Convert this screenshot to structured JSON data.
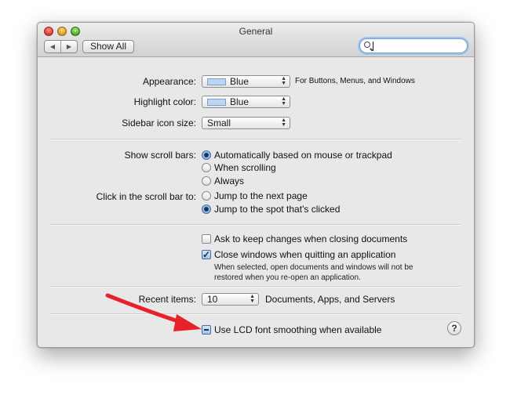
{
  "window": {
    "title": "General"
  },
  "toolbar": {
    "back": "◀",
    "forward": "▶",
    "show_all": "Show All",
    "search_placeholder": ""
  },
  "appearance": {
    "label": "Appearance:",
    "value": "Blue",
    "note": "For Buttons, Menus, and Windows"
  },
  "highlight": {
    "label": "Highlight color:",
    "value": "Blue"
  },
  "sidebar_icon": {
    "label": "Sidebar icon size:",
    "value": "Small"
  },
  "scroll_bars": {
    "label": "Show scroll bars:",
    "options": [
      "Automatically based on mouse or trackpad",
      "When scrolling",
      "Always"
    ],
    "selected": "Automatically based on mouse or trackpad"
  },
  "click_scroll": {
    "label": "Click in the scroll bar to:",
    "options": [
      "Jump to the next page",
      "Jump to the spot that's clicked"
    ],
    "selected": "Jump to the spot that's clicked"
  },
  "documents": {
    "ask_keep": {
      "label": "Ask to keep changes when closing documents",
      "checked": false
    },
    "close_windows": {
      "label": "Close windows when quitting an application",
      "checked": true
    },
    "help_line1": "When selected, open documents and windows will not be",
    "help_line2": "restored when you re-open an application."
  },
  "recent": {
    "label": "Recent items:",
    "value": "10",
    "note": "Documents, Apps, and Servers"
  },
  "lcd": {
    "label": "Use LCD font smoothing when available",
    "state": "mixed"
  },
  "help_button": "?",
  "colors": {
    "arrow": "#e8202a",
    "swatch": "#bcd5f0",
    "focus_ring": "#9cc2f0"
  }
}
